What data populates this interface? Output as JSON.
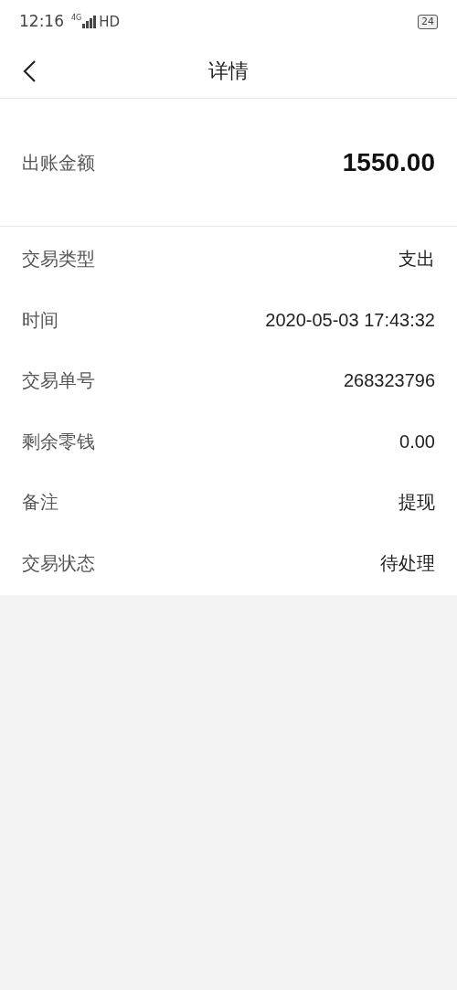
{
  "status_bar": {
    "time": "12:16",
    "network": "4G",
    "hd": "HD",
    "battery": "24"
  },
  "nav": {
    "title": "详情"
  },
  "amount": {
    "label": "出账金额",
    "value": "1550.00"
  },
  "rows": [
    {
      "label": "交易类型",
      "value": "支出"
    },
    {
      "label": "时间",
      "value": "2020-05-03 17:43:32"
    },
    {
      "label": "交易单号",
      "value": "268323796"
    },
    {
      "label": "剩余零钱",
      "value": "0.00"
    },
    {
      "label": "备注",
      "value": "提现"
    },
    {
      "label": "交易状态",
      "value": "待处理"
    }
  ]
}
